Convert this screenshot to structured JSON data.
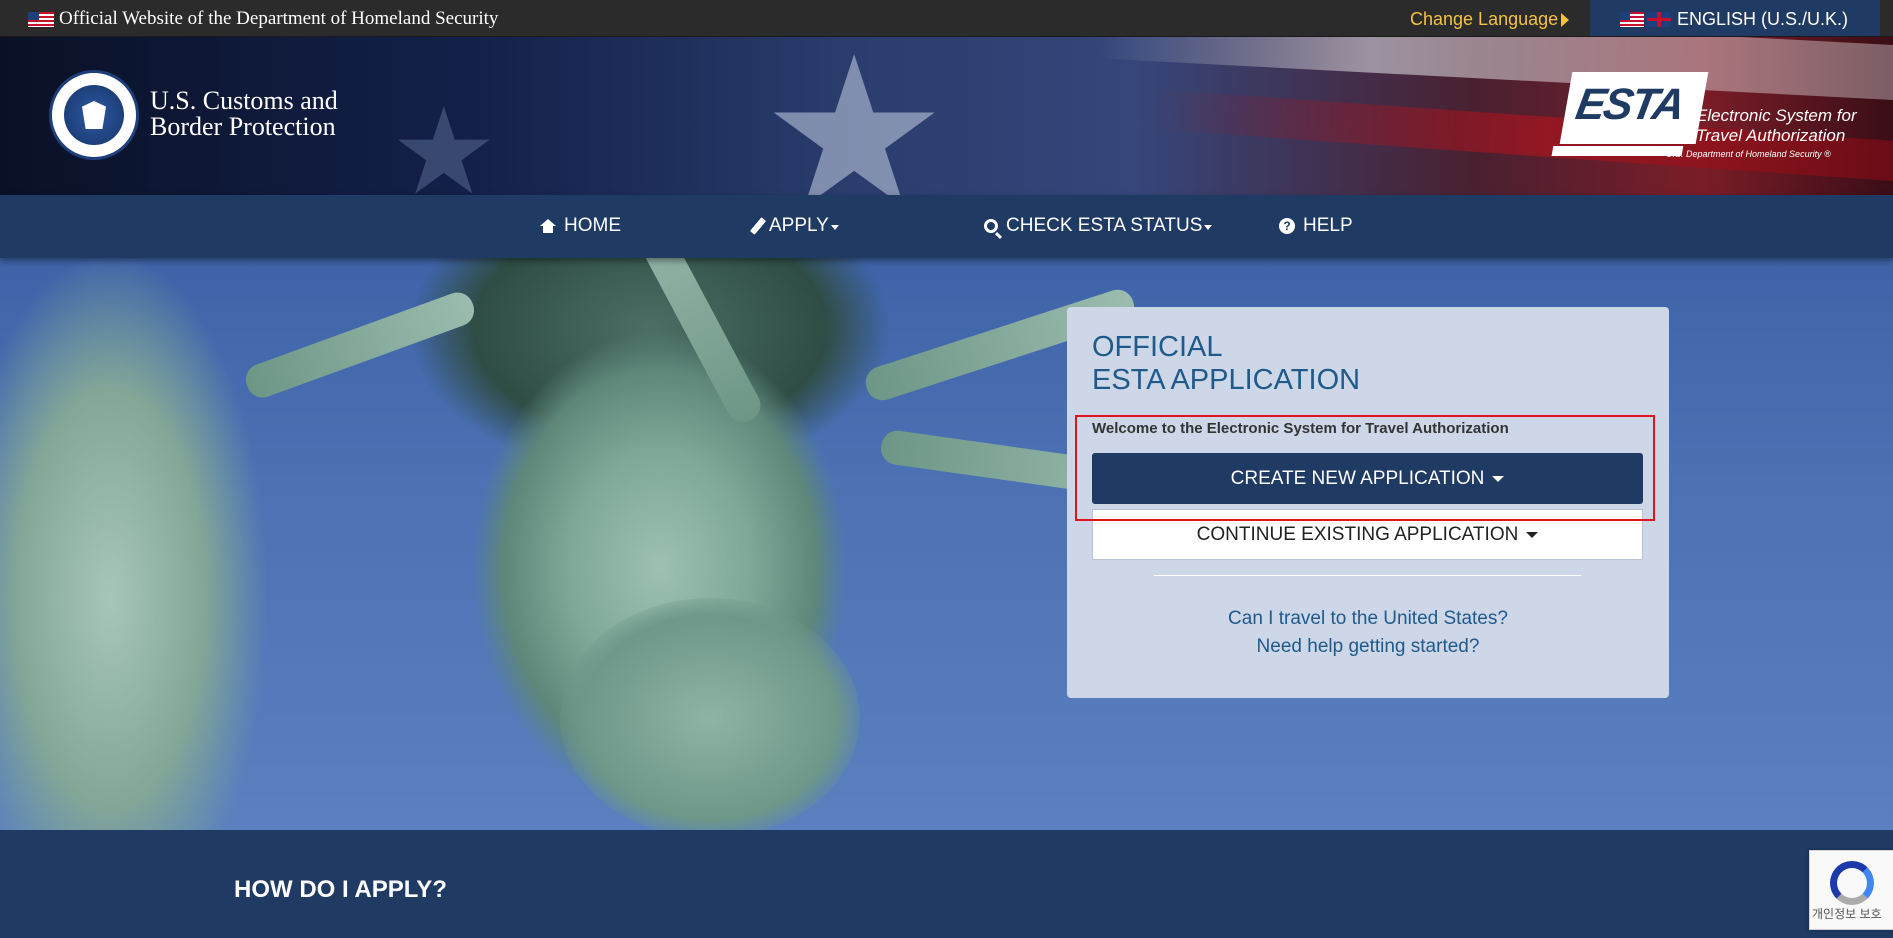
{
  "gov_bar": {
    "official_text": "Official Website of the Department of Homeland Security",
    "change_language": "Change Language",
    "language": "ENGLISH (U.S./U.K.)"
  },
  "header": {
    "agency_name_line1": "U.S. Customs and",
    "agency_name_line2": "Border Protection",
    "esta_logo_text": "ESTA",
    "esta_tagline_line1": "Electronic System for",
    "esta_tagline_line2": "Travel Authorization",
    "esta_sub": "U.S. Department of Homeland Security ®"
  },
  "nav": {
    "items": [
      {
        "label": "HOME",
        "icon": "home-icon"
      },
      {
        "label": "APPLY",
        "icon": "pencil-icon"
      },
      {
        "label": "CHECK ESTA STATUS",
        "icon": "search-icon"
      },
      {
        "label": "HELP",
        "icon": "question-circle-icon"
      }
    ]
  },
  "card": {
    "title_line1": "OFFICIAL",
    "title_line2": "ESTA APPLICATION",
    "welcome": "Welcome to the Electronic System for Travel Authorization",
    "create_button": "CREATE NEW APPLICATION",
    "continue_button": "CONTINUE EXISTING APPLICATION",
    "link_travel": "Can I travel to the United States?",
    "link_help": "Need help getting started?"
  },
  "section": {
    "how_apply": "HOW DO I APPLY?"
  },
  "recaptcha": {
    "text": "개인정보 보호"
  },
  "colors": {
    "navy": "#1f3a63",
    "link_blue": "#1f5a8a",
    "card_bg": "#cdd7e8",
    "highlight_red": "#e0141c",
    "change_language_gold": "#f5c242"
  }
}
